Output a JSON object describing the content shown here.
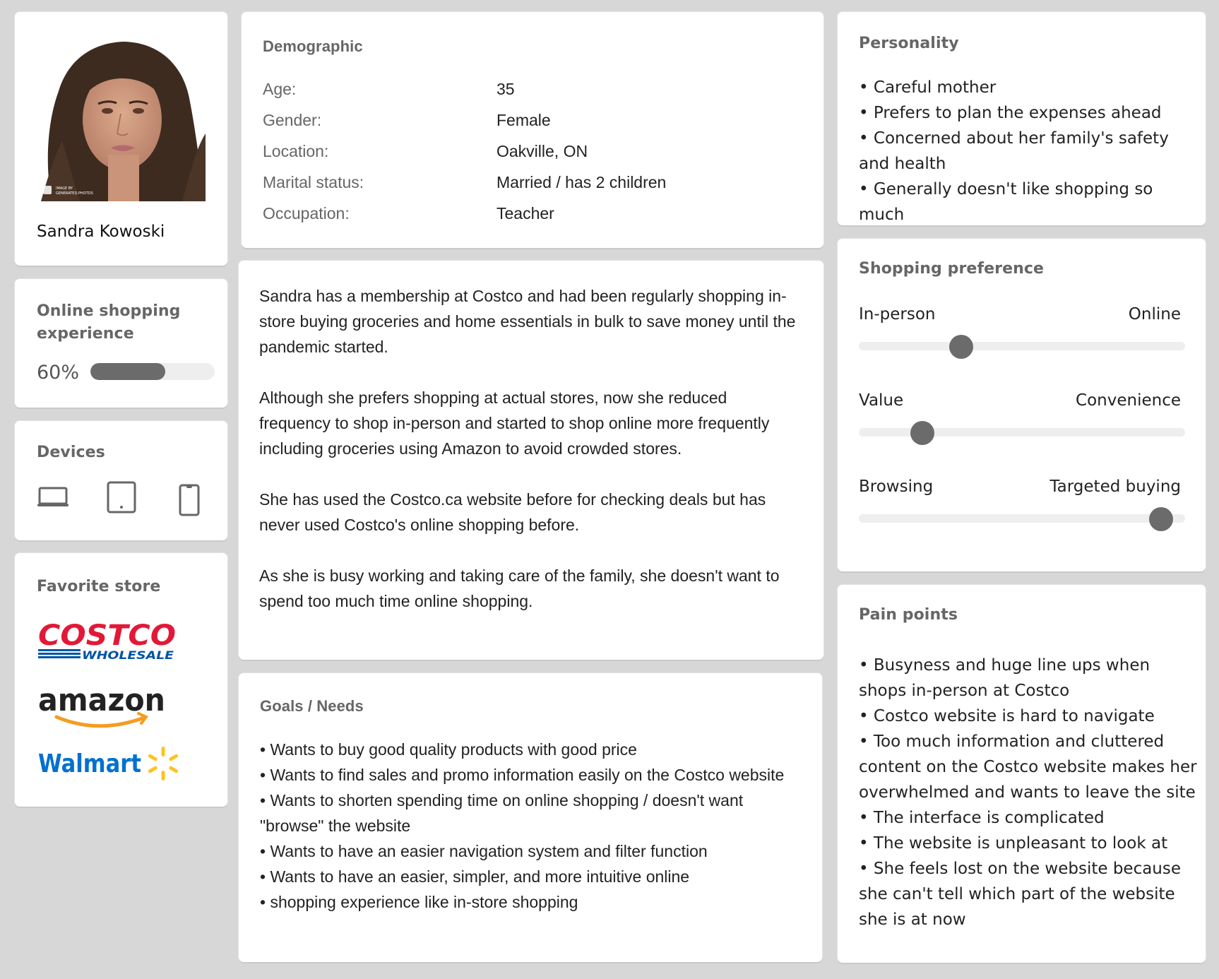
{
  "profile": {
    "name": "Sandra Kowoski",
    "photo_credit": [
      "IMAGE BY",
      "GENERATED.PHOTOS"
    ]
  },
  "online_experience": {
    "title": "Online shopping experience",
    "percent_label": "60%",
    "value": 0.6
  },
  "devices": {
    "title": "Devices",
    "items": [
      {
        "icon": "laptop-icon"
      },
      {
        "icon": "tablet-icon"
      },
      {
        "icon": "smartphone-icon"
      }
    ]
  },
  "favorite_store": {
    "title": "Favorite store",
    "stores": [
      {
        "name": "Costco",
        "wordmark": "COSTCO",
        "subtitle": "WHOLESALE",
        "color": "#e31837",
        "accent": "#0054a4"
      },
      {
        "name": "Amazon",
        "wordmark": "amazon",
        "color": "#222222",
        "accent": "#f49c21"
      },
      {
        "name": "Walmart",
        "wordmark": "Walmart",
        "color": "#0071ce",
        "accent": "#ffc220"
      }
    ]
  },
  "demographic": {
    "title": "Demographic",
    "rows": [
      {
        "label": "Age:",
        "value": "35"
      },
      {
        "label": "Gender:",
        "value": "Female"
      },
      {
        "label": "Location:",
        "value": "Oakville, ON"
      },
      {
        "label": "Marital status:",
        "value": "Married / has 2 children"
      },
      {
        "label": "Occupation:",
        "value": "Teacher"
      }
    ]
  },
  "story": {
    "paragraphs": [
      "Sandra has a membership at Costco and had been regularly shopping in-store buying groceries and home essentials in bulk to save money until the pandemic started.",
      "Although she prefers shopping at actual stores, now she reduced frequency to shop in-person and started to shop online more frequently including groceries using Amazon to avoid crowded stores.",
      "She has used the Costco.ca website before for checking deals but has never used Costco's online shopping before.",
      "As she is busy working and taking care of the family, she doesn't want to spend too much time online shopping."
    ]
  },
  "goals": {
    "title": "Goals / Needs",
    "items": [
      "Wants to buy good quality products with good price",
      "Wants to find sales and promo information easily on the Costco website",
      "Wants to shorten spending time on online shopping / doesn't want \"browse\" the website",
      "Wants to have an easier navigation system and filter function",
      "Wants to have an easier, simpler, and more intuitive online",
      "shopping experience like in-store shopping"
    ]
  },
  "personality": {
    "title": "Personality",
    "items": [
      "Careful mother",
      "Prefers to plan the expenses ahead",
      "Concerned about her family's safety and health",
      "Generally doesn't like shopping so much"
    ]
  },
  "shopping_preference": {
    "title": "Shopping preference",
    "sliders": [
      {
        "left": "In-person",
        "right": "Online",
        "value": 0.3
      },
      {
        "left": "Value",
        "right": "Convenience",
        "value": 0.17
      },
      {
        "left": "Browsing",
        "right": "Targeted buying",
        "value": 0.96
      }
    ]
  },
  "pain_points": {
    "title": "Pain points",
    "items": [
      "Busyness and huge line ups when shops in-person at Costco",
      "Costco website is hard to navigate",
      "Too much information and cluttered content on the Costco website makes her overwhelmed and wants to leave the site",
      "The interface is complicated",
      "The website is unpleasant to look at",
      "She feels lost on the website because she can't tell which part of the website she is at now"
    ]
  }
}
